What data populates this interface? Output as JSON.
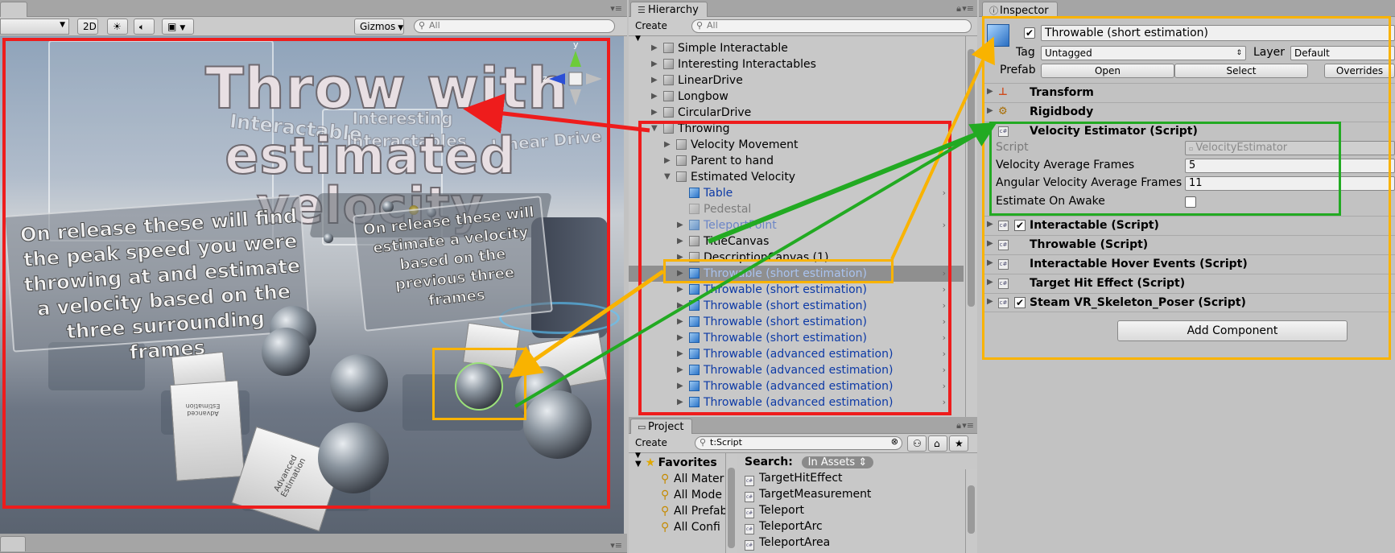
{
  "scene": {
    "toolbar": {
      "mode_2d": "2D",
      "gizmos_label": "Gizmos",
      "search_placeholder": "All"
    },
    "title_line1": "Throw with",
    "title_line2": "estimated velocity",
    "bg_text_1": "Interactable",
    "bg_text_2": "Interesting Interactables",
    "bg_text_3": "Linear Drive",
    "left_sign": "On release these will find the peak speed you were throwing at and estimate a velocity based on the three surrounding frames",
    "right_sign": "On release these will estimate a velocity based on the previous three frames",
    "cube_label_1": "Advanced Estimation",
    "cube_label_2": "Advanced Estimation",
    "gizmo_y": "y",
    "gizmo_z": "z"
  },
  "hierarchy": {
    "tab_title": "Hierarchy",
    "create_label": "Create",
    "search_placeholder": "All",
    "rows": [
      {
        "label": "Simple Interactable"
      },
      {
        "label": "Interesting Interactables"
      },
      {
        "label": "LinearDrive"
      },
      {
        "label": "Longbow"
      },
      {
        "label": "CircularDrive"
      },
      {
        "label": "Throwing"
      },
      {
        "label": "Velocity Movement"
      },
      {
        "label": "Parent to hand"
      },
      {
        "label": "Estimated Velocity"
      },
      {
        "label": "Table"
      },
      {
        "label": "Pedestal"
      },
      {
        "label": "TeleportPoint"
      },
      {
        "label": "TitleCanvas"
      },
      {
        "label": "DescriptionCanvas (1)"
      },
      {
        "label": "Throwable (short estimation)"
      },
      {
        "label": "Throwable (short estimation)"
      },
      {
        "label": "Throwable (short estimation)"
      },
      {
        "label": "Throwable (short estimation)"
      },
      {
        "label": "Throwable (short estimation)"
      },
      {
        "label": "Throwable (advanced estimation)"
      },
      {
        "label": "Throwable (advanced estimation)"
      },
      {
        "label": "Throwable (advanced estimation)"
      },
      {
        "label": "Throwable (advanced estimation)"
      }
    ]
  },
  "project": {
    "tab_title": "Project",
    "create_label": "Create",
    "search_value": "t:Script",
    "favorites_label": "Favorites",
    "favorites": [
      "All Mater",
      "All Mode",
      "All Prefab",
      "All Confi"
    ],
    "search_label": "Search:",
    "scope_label": "In Assets",
    "results": [
      "TargetHitEffect",
      "TargetMeasurement",
      "Teleport",
      "TeleportArc",
      "TeleportArea"
    ]
  },
  "inspector": {
    "tab_title": "Inspector",
    "object_name": "Throwable (short estimation)",
    "tag_label": "Tag",
    "tag_value": "Untagged",
    "layer_label": "Layer",
    "layer_value": "Default",
    "prefab_label": "Prefab",
    "open_label": "Open",
    "select_label": "Select",
    "overrides_label": "Overrides",
    "components": {
      "transform": "Transform",
      "rigidbody": "Rigidbody",
      "velocity_estimator": "Velocity Estimator (Script)",
      "interactable": "Interactable (Script)",
      "throwable": "Throwable (Script)",
      "hover_events": "Interactable Hover Events (Script)",
      "target_hit": "Target Hit Effect (Script)",
      "skeleton_poser": "Steam VR_Skeleton_Poser (Script)"
    },
    "ve_fields": {
      "script_label": "Script",
      "script_value": "VelocityEstimator",
      "vaf_label": "Velocity Average Frames",
      "vaf_value": "5",
      "avaf_label": "Angular Velocity Average Frames",
      "avaf_value": "11",
      "eoa_label": "Estimate On Awake"
    },
    "add_component_label": "Add Component"
  },
  "colors": {
    "red_annotation": "#ee1c1c",
    "yellow_annotation": "#f9b300",
    "green_annotation": "#22aa22",
    "prefab_text": "#0d3aa6"
  }
}
